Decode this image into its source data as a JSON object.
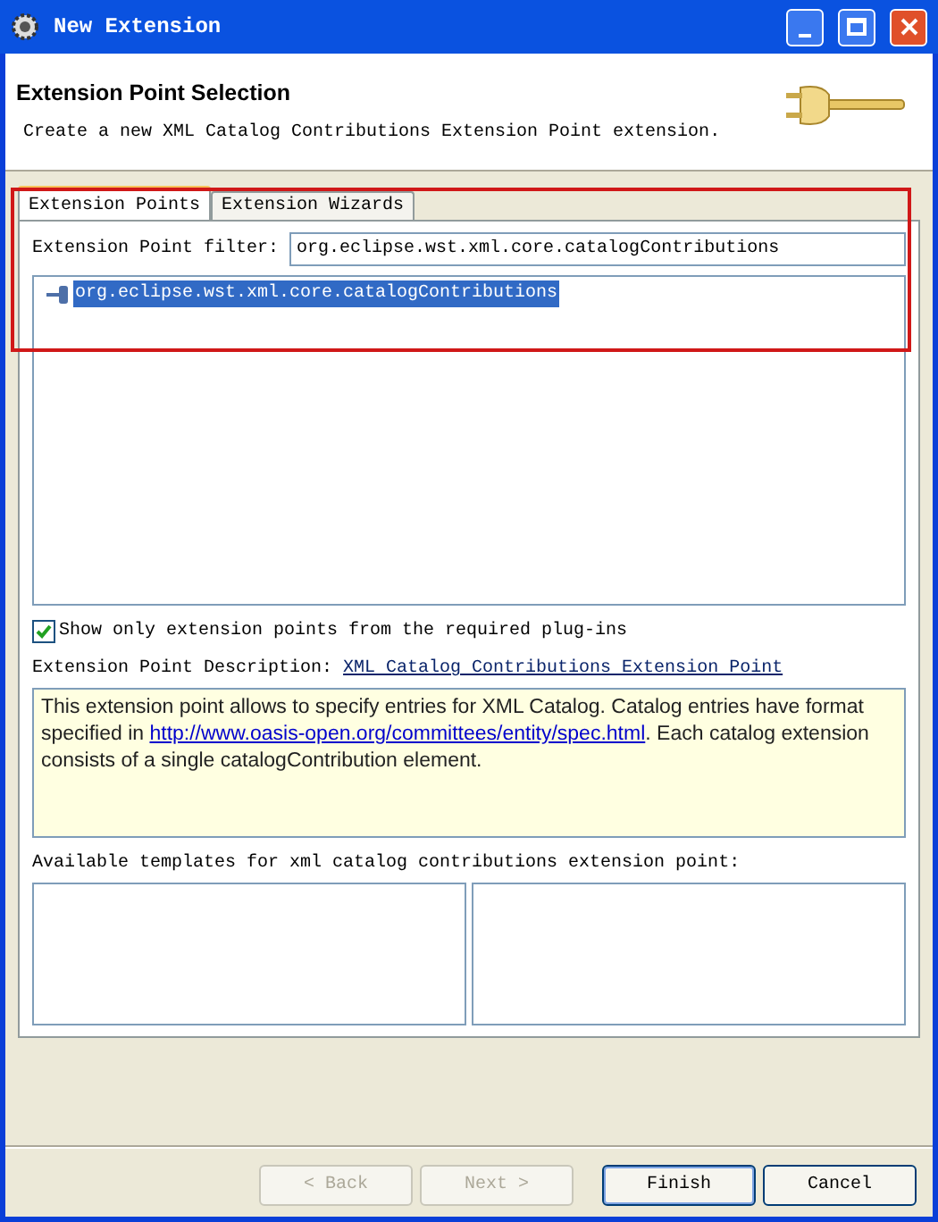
{
  "window": {
    "title": "New Extension"
  },
  "header": {
    "title": "Extension Point Selection",
    "subtitle": "Create a new XML Catalog Contributions Extension Point extension."
  },
  "tabs": [
    {
      "label": "Extension Points",
      "selected": true
    },
    {
      "label": "Extension Wizards",
      "selected": false
    }
  ],
  "filter": {
    "label": "Extension Point filter:",
    "value": "org.eclipse.wst.xml.core.catalogContributions"
  },
  "extension_points": [
    {
      "label": "org.eclipse.wst.xml.core.catalogContributions",
      "selected": true
    }
  ],
  "show_required_only": {
    "label": "Show only extension points from the required plug-ins",
    "checked": true
  },
  "description": {
    "label": "Extension Point Description:",
    "link": "XML Catalog Contributions Extension Point",
    "text_before": "This extension point allows to specify entries for XML Catalog. Catalog entries have format specified in ",
    "text_link": "http://www.oasis-open.org/committees/entity/spec.html",
    "text_after": ". Each catalog extension consists of a single catalogContribution element."
  },
  "templates": {
    "label": "Available templates for xml catalog contributions extension point:"
  },
  "buttons": [
    {
      "label": "< Back",
      "disabled": true,
      "default": false
    },
    {
      "label": "Next >",
      "disabled": true,
      "default": false
    },
    {
      "label": "Finish",
      "disabled": false,
      "default": true
    },
    {
      "label": "Cancel",
      "disabled": false,
      "default": false
    }
  ]
}
